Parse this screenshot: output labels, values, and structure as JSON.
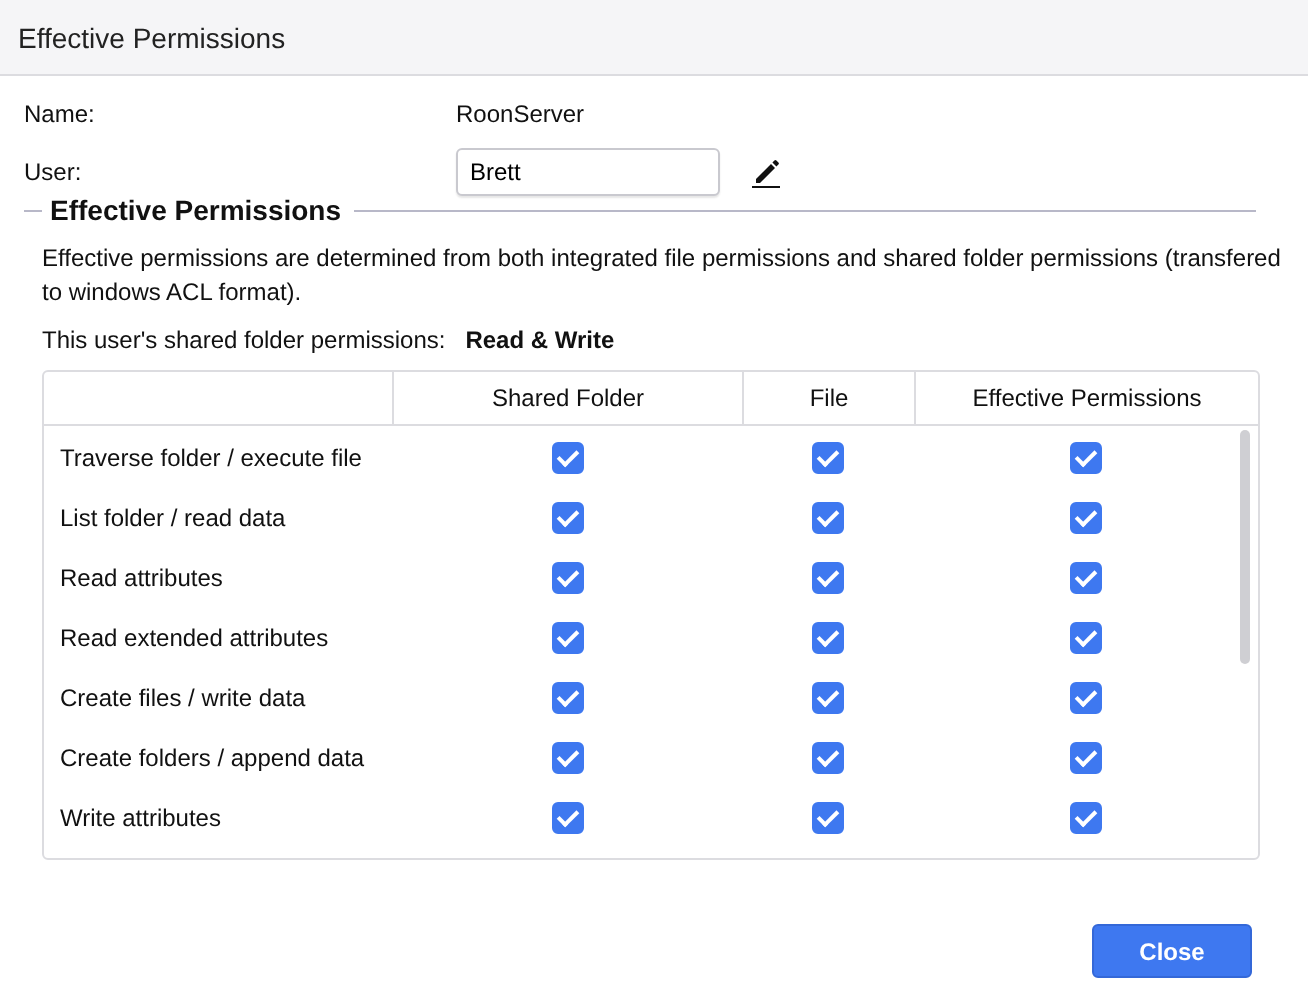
{
  "window": {
    "title": "Effective Permissions"
  },
  "fields": [
    {
      "kind": "text",
      "label": "Name:",
      "value": "RoonServer"
    },
    {
      "kind": "input",
      "label": "User:",
      "value": "Brett"
    }
  ],
  "section": {
    "title": "Effective Permissions",
    "description": "Effective permissions are determined from both integrated file permissions and shared folder permissions (transfered to windows ACL format).",
    "summary_label": "This user's shared folder permissions:",
    "summary_value": "Read & Write"
  },
  "table": {
    "columns": [
      "Shared Folder",
      "File",
      "Effective Permissions"
    ],
    "rows": [
      {
        "name": "Traverse folder / execute file",
        "checked": [
          true,
          true,
          true
        ]
      },
      {
        "name": "List folder / read data",
        "checked": [
          true,
          true,
          true
        ]
      },
      {
        "name": "Read attributes",
        "checked": [
          true,
          true,
          true
        ]
      },
      {
        "name": "Read extended attributes",
        "checked": [
          true,
          true,
          true
        ]
      },
      {
        "name": "Create files / write data",
        "checked": [
          true,
          true,
          true
        ]
      },
      {
        "name": "Create folders / append data",
        "checked": [
          true,
          true,
          true
        ]
      },
      {
        "name": "Write attributes",
        "checked": [
          true,
          true,
          true
        ]
      }
    ]
  },
  "buttons": [
    "Close"
  ]
}
